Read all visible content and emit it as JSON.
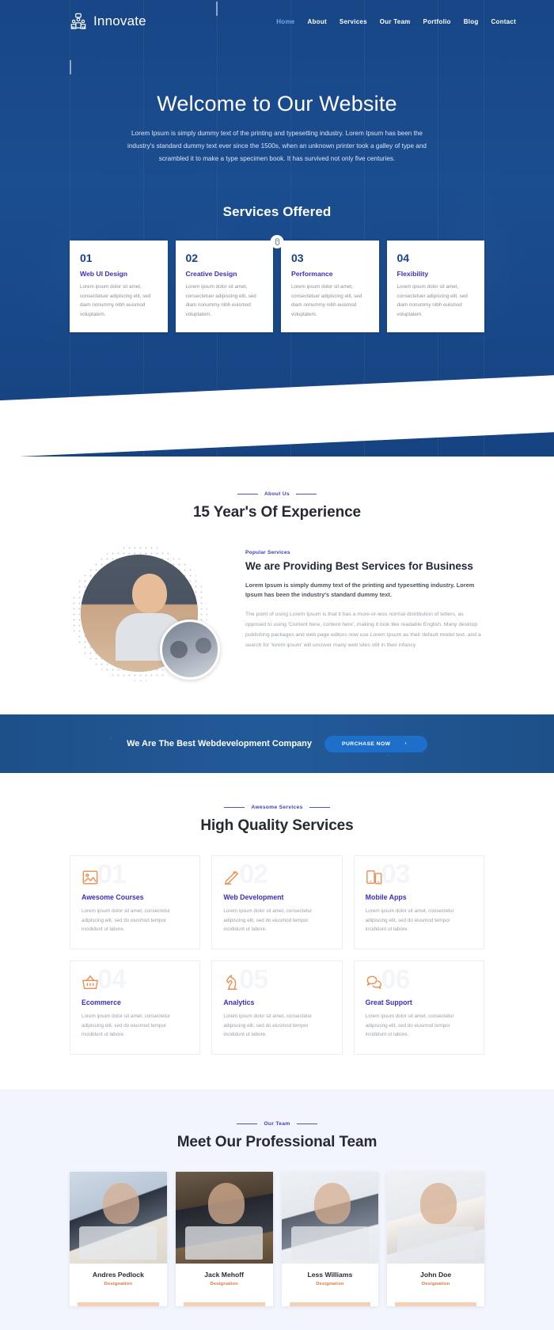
{
  "nav": {
    "brand": "Innovate",
    "brand_icon": "people-group-icon",
    "links": [
      {
        "label": "Home",
        "active": true
      },
      {
        "label": "About",
        "active": false
      },
      {
        "label": "Services",
        "active": false
      },
      {
        "label": "Our Team",
        "active": false
      },
      {
        "label": "Portfolio",
        "active": false
      },
      {
        "label": "Blog",
        "active": false
      },
      {
        "label": "Contact",
        "active": false
      }
    ]
  },
  "hero": {
    "title": "Welcome to Our Website",
    "subtitle": "Lorem Ipsum is simply dummy text of the printing and typesetting industry. Lorem Ipsum has been the industry's standard dummy text ever since the 1500s, when an unknown printer took a galley of type and scrambled it to make a type specimen book. It has survived not only five centuries.",
    "scroll_icon": "mouse-scroll-icon"
  },
  "services_offered": {
    "title": "Services Offered",
    "cards": [
      {
        "num": "01",
        "name": "Web UI Design",
        "text": "Lorem ipsum dolor sit amet, consectetuer adipiscing elit, sed diam nonummy nibh euismod voluptatem."
      },
      {
        "num": "02",
        "name": "Creative Design",
        "text": "Lorem ipsum dolor sit amet, consectetuer adipiscing elit, sed diam nonummy nibh euismod voluptatem."
      },
      {
        "num": "03",
        "name": "Performance",
        "text": "Lorem ipsum dolor sit amet, consectetuer adipiscing elit, sed diam nonummy nibh euismod voluptatem."
      },
      {
        "num": "04",
        "name": "Flexibility",
        "text": "Lorem ipsum dolor sit amet, consectetuer adipiscing elit, sed diam nonummy nibh euismod voluptatem."
      }
    ]
  },
  "about": {
    "eyebrow": "About Us",
    "title": "15 Year's Of Experience",
    "kicker": "Popular Services",
    "heading": "We are Providing Best Services for Business",
    "lead": "Lorem Ipsum is simply dummy text of the printing and typesetting industry. Lorem Ipsum has been the industry's standard dummy text.",
    "body": "The point of using Lorem Ipsum is that it has a more-or-less normal distribution of letters, as opposed to using 'Content here, content here', making it look like readable English. Many desktop publishing packages and web page editors now use Lorem Ipsum as their default model text, and a search for 'lorem ipsum' will uncover many web sites still in their infancy"
  },
  "cta": {
    "text": "We Are The Best Webdevelopment Company",
    "button": "PURCHASE NOW",
    "button_arrow": "›"
  },
  "high_quality": {
    "eyebrow": "Awesome Services",
    "title": "High Quality Services",
    "cards": [
      {
        "num": "01",
        "icon": "image-icon",
        "name": "Awesome Courses",
        "text": "Lorem ipsum dolor sit amet, consectetur adipiscing elit, sed do eiusmod tempor incididunt ut labore."
      },
      {
        "num": "02",
        "icon": "pencil-icon",
        "name": "Web Development",
        "text": "Lorem ipsum dolor sit amet, consectetur adipiscing elit, sed do eiusmod tempor incididunt ut labore."
      },
      {
        "num": "03",
        "icon": "mobile-devices-icon",
        "name": "Mobile Apps",
        "text": "Lorem ipsum dolor sit amet, consectetur adipiscing elit, sed do eiusmod tempor incididunt ut labore."
      },
      {
        "num": "04",
        "icon": "shopping-basket-icon",
        "name": "Ecommerce",
        "text": "Lorem ipsum dolor sit amet, consectetur adipiscing elit, sed do eiusmod tempor incididunt ut labore."
      },
      {
        "num": "05",
        "icon": "chess-knight-icon",
        "name": "Analytics",
        "text": "Lorem ipsum dolor sit amet, consectetur adipiscing elit, sed do eiusmod tempor incididunt ut labore."
      },
      {
        "num": "06",
        "icon": "chat-bubbles-icon",
        "name": "Great Support",
        "text": "Lorem ipsum dolor sit amet, consectetur adipiscing elit, sed do eiusmod tempor incididunt ut labore."
      }
    ]
  },
  "team": {
    "eyebrow": "Our Team",
    "title": "Meet Our Professional Team",
    "members": [
      {
        "name": "Andres Pedlock",
        "role": "Designation"
      },
      {
        "name": "Jack Mehoff",
        "role": "Designation"
      },
      {
        "name": "Less Williams",
        "role": "Designation"
      },
      {
        "name": "John Doe",
        "role": "Designation"
      }
    ]
  },
  "colors": {
    "hero_blue": "#1c4e8f",
    "cta_blue": "#1e5390",
    "accent_purple": "#3b2fc9",
    "accent_orange": "#ef8b4f",
    "team_bg": "#f2f5fd"
  }
}
